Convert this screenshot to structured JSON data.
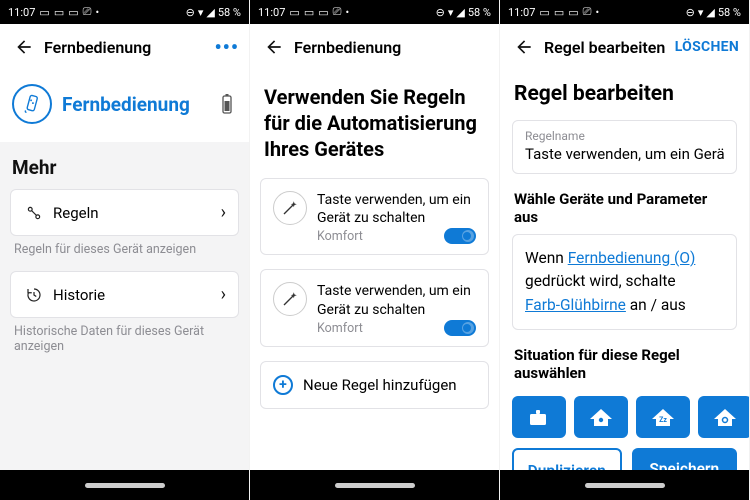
{
  "statusbar": {
    "time": "11:07",
    "battery": "58 %"
  },
  "screen1": {
    "title": "Fernbedienung",
    "device_name": "Fernbedienung",
    "more_heading": "Mehr",
    "rules_label": "Regeln",
    "rules_sub": "Regeln für dieses Gerät anzeigen",
    "history_label": "Historie",
    "history_sub": "Historische Daten für dieses Gerät anzeigen"
  },
  "screen2": {
    "title": "Fernbedienung",
    "heading": "Verwenden Sie Regeln für die Automatisierung Ihres Gerätes",
    "rule1_title": "Taste verwenden, um ein Gerät zu schalten",
    "rule1_sub": "Komfort",
    "rule2_title": "Taste verwenden, um ein Gerät zu schalten",
    "rule2_sub": "Komfort",
    "add_rule": "Neue Regel hinzufügen"
  },
  "screen3": {
    "title": "Regel bearbeiten",
    "delete": "LÖSCHEN",
    "heading": "Regel bearbeiten",
    "name_label": "Regelname",
    "name_value": "Taste verwenden, um ein Gerä",
    "params_heading": "Wähle Geräte und Parameter aus",
    "sentence_pre": "Wenn ",
    "sentence_link1": "Fernbedienung (O)",
    "sentence_mid": " gedrückt wird, schalte ",
    "sentence_link2": "Farb-Glühbirne",
    "sentence_post": "  an / aus",
    "situation_heading": "Situation für diese Regel auswählen",
    "duplicate": "Duplizieren",
    "save": "Speichern"
  }
}
